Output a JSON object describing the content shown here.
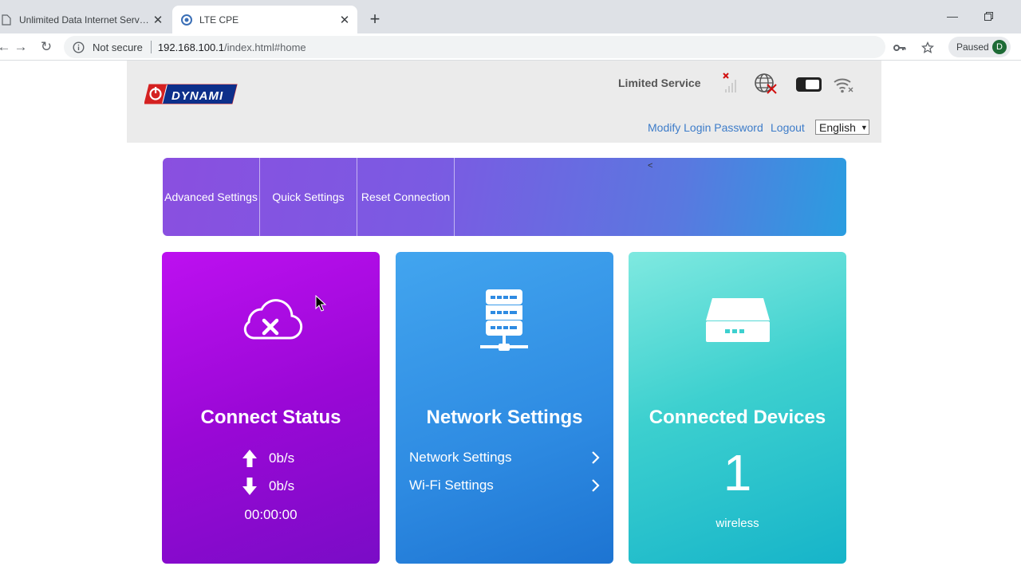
{
  "browser": {
    "tabs": [
      {
        "title": "Unlimited Data Internet Service -",
        "active": false
      },
      {
        "title": "LTE CPE",
        "active": true
      }
    ],
    "address": {
      "security_label": "Not secure",
      "host": "192.168.100.1",
      "path": "/index.html#home"
    },
    "profile": {
      "label": "Paused",
      "initial": "D"
    }
  },
  "header": {
    "logo_text": "DYNAMI",
    "service_status": "Limited Service",
    "links": {
      "modify_password": "Modify Login Password",
      "logout": "Logout"
    },
    "language": "English"
  },
  "menu": {
    "items": [
      {
        "label": "Advanced Settings"
      },
      {
        "label": "Quick Settings"
      },
      {
        "label": "Reset Connection"
      }
    ],
    "arrow": "<"
  },
  "cards": {
    "status": {
      "title": "Connect Status",
      "upload": "0b/s",
      "download": "0b/s",
      "duration": "00:00:00"
    },
    "network": {
      "title": "Network Settings",
      "links": [
        {
          "label": "Network Settings"
        },
        {
          "label": "Wi-Fi Settings"
        }
      ]
    },
    "devices": {
      "title": "Connected Devices",
      "count": "1",
      "type": "wireless"
    }
  },
  "colors": {
    "status_card": "#a40ae0",
    "network_card": "#2e8be2",
    "devices_card": "#3dd0cf",
    "link_blue": "#3d7cc9"
  }
}
